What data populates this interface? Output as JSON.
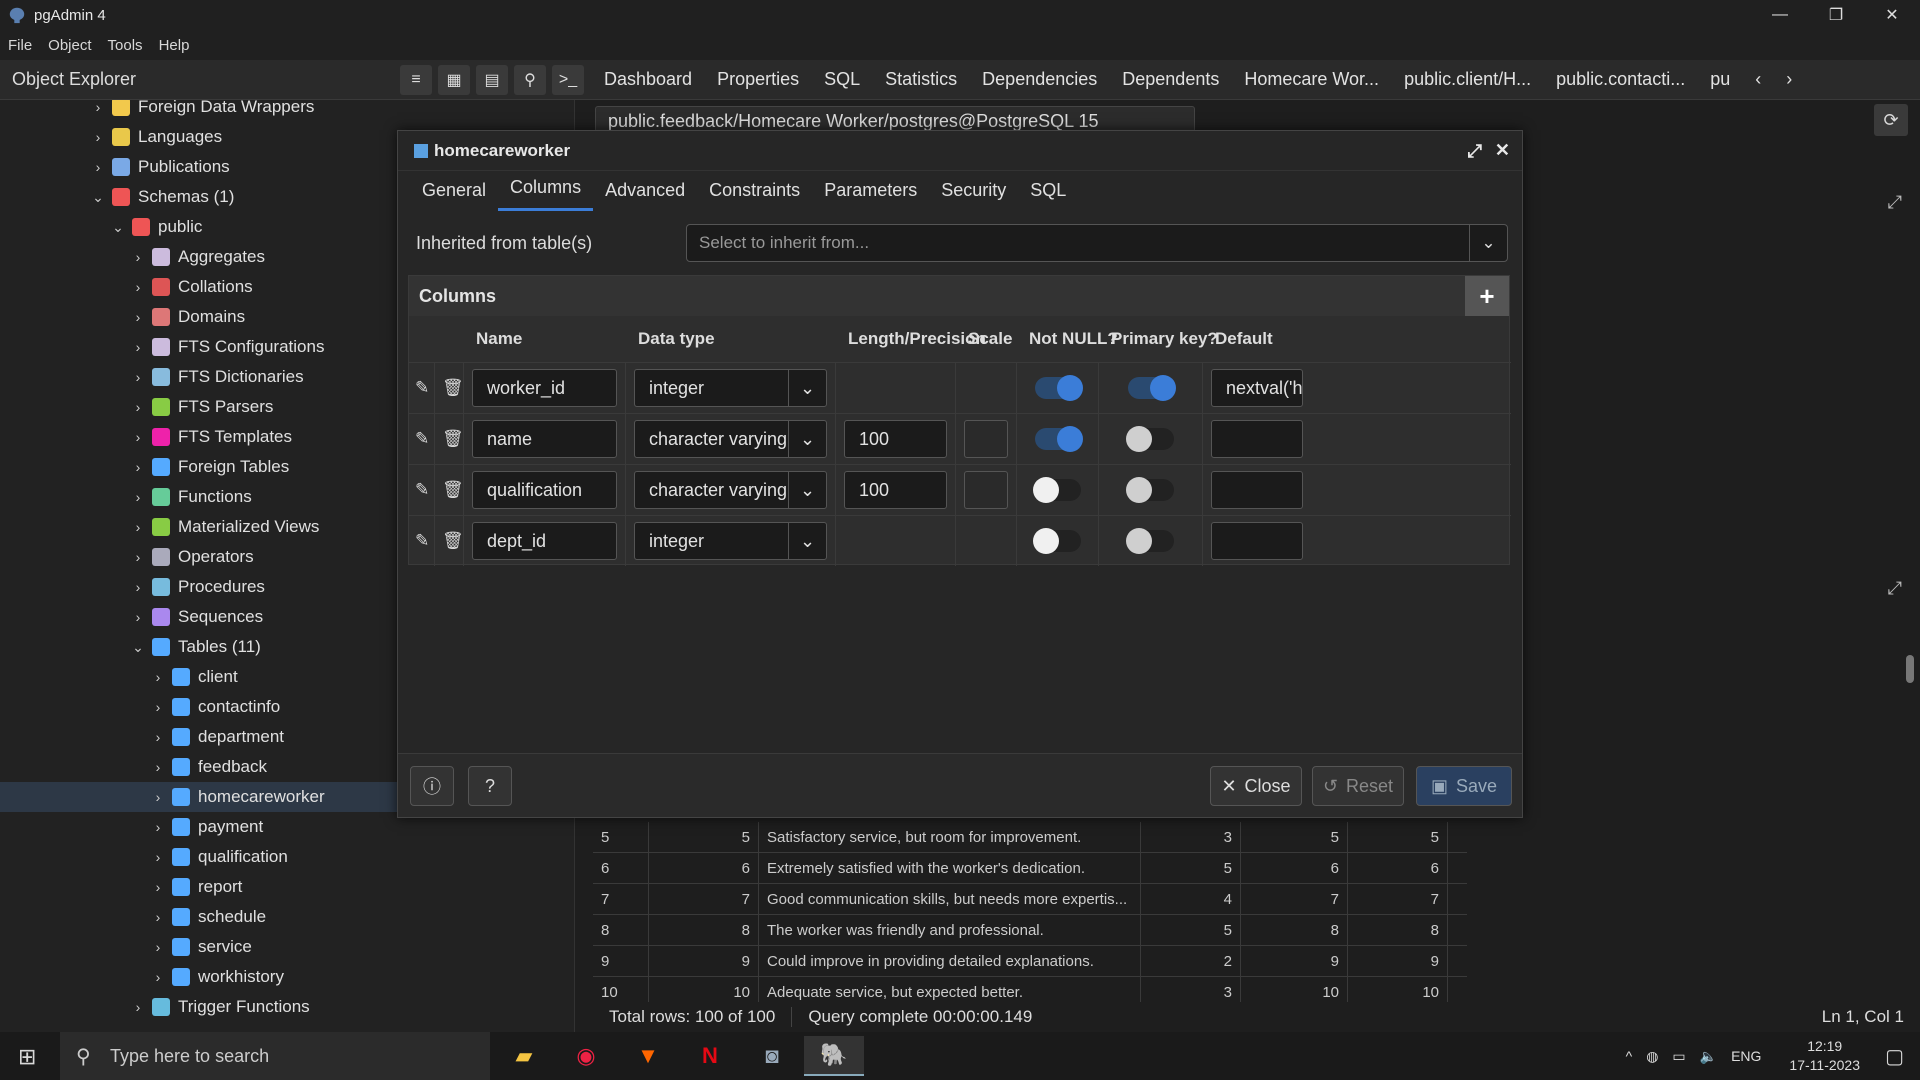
{
  "window": {
    "title": "pgAdmin 4"
  },
  "menu": [
    "File",
    "Object",
    "Tools",
    "Help"
  ],
  "explorer_title": "Object Explorer",
  "main_tabs": [
    "Dashboard",
    "Properties",
    "SQL",
    "Statistics",
    "Dependencies",
    "Dependents",
    "Homecare Wor...",
    "public.client/H...",
    "public.contacti...",
    "pu"
  ],
  "tree": [
    {
      "label": "Foreign Data Wrappers",
      "depth": 4,
      "exp": ">"
    },
    {
      "label": "Languages",
      "depth": 4,
      "exp": ">"
    },
    {
      "label": "Publications",
      "depth": 4,
      "exp": ">"
    },
    {
      "label": "Schemas (1)",
      "depth": 4,
      "exp": "v"
    },
    {
      "label": "public",
      "depth": 5,
      "exp": "v"
    },
    {
      "label": "Aggregates",
      "depth": 6,
      "exp": ">"
    },
    {
      "label": "Collations",
      "depth": 6,
      "exp": ">"
    },
    {
      "label": "Domains",
      "depth": 6,
      "exp": ">"
    },
    {
      "label": "FTS Configurations",
      "depth": 6,
      "exp": ">"
    },
    {
      "label": "FTS Dictionaries",
      "depth": 6,
      "exp": ">"
    },
    {
      "label": "FTS Parsers",
      "depth": 6,
      "exp": ">"
    },
    {
      "label": "FTS Templates",
      "depth": 6,
      "exp": ">"
    },
    {
      "label": "Foreign Tables",
      "depth": 6,
      "exp": ">"
    },
    {
      "label": "Functions",
      "depth": 6,
      "exp": ">"
    },
    {
      "label": "Materialized Views",
      "depth": 6,
      "exp": ">"
    },
    {
      "label": "Operators",
      "depth": 6,
      "exp": ">"
    },
    {
      "label": "Procedures",
      "depth": 6,
      "exp": ">"
    },
    {
      "label": "Sequences",
      "depth": 6,
      "exp": ">"
    },
    {
      "label": "Tables (11)",
      "depth": 6,
      "exp": "v"
    },
    {
      "label": "client",
      "depth": 7,
      "exp": ">"
    },
    {
      "label": "contactinfo",
      "depth": 7,
      "exp": ">"
    },
    {
      "label": "department",
      "depth": 7,
      "exp": ">"
    },
    {
      "label": "feedback",
      "depth": 7,
      "exp": ">"
    },
    {
      "label": "homecareworker",
      "depth": 7,
      "exp": ">",
      "selected": true
    },
    {
      "label": "payment",
      "depth": 7,
      "exp": ">"
    },
    {
      "label": "qualification",
      "depth": 7,
      "exp": ">"
    },
    {
      "label": "report",
      "depth": 7,
      "exp": ">"
    },
    {
      "label": "schedule",
      "depth": 7,
      "exp": ">"
    },
    {
      "label": "service",
      "depth": 7,
      "exp": ">"
    },
    {
      "label": "workhistory",
      "depth": 7,
      "exp": ">"
    },
    {
      "label": "Trigger Functions",
      "depth": 6,
      "exp": ">"
    }
  ],
  "query_tab": "public.feedback/Homecare Worker/postgres@PostgreSQL 15",
  "dialog": {
    "title": "homecareworker",
    "tabs": [
      "General",
      "Columns",
      "Advanced",
      "Constraints",
      "Parameters",
      "Security",
      "SQL"
    ],
    "active_tab": "Columns",
    "inherit_label": "Inherited from table(s)",
    "inherit_placeholder": "Select to inherit from...",
    "columns_title": "Columns",
    "headers": [
      "Name",
      "Data type",
      "Length/Precision",
      "Scale",
      "Not NULL?",
      "Primary key?",
      "Default"
    ],
    "rows": [
      {
        "name": "worker_id",
        "type": "integer",
        "length": "",
        "scale": "",
        "notnull": true,
        "pk": true,
        "default": "nextval('ho",
        "editable_len": false
      },
      {
        "name": "name",
        "type": "character varying",
        "length": "100",
        "scale": "",
        "notnull": true,
        "pk": false,
        "default": "",
        "editable_len": true
      },
      {
        "name": "qualification",
        "type": "character varying",
        "length": "100",
        "scale": "",
        "notnull": false,
        "pk": false,
        "default": "",
        "editable_len": true
      },
      {
        "name": "dept_id",
        "type": "integer",
        "length": "",
        "scale": "",
        "notnull": false,
        "pk": false,
        "default": "",
        "editable_len": false
      }
    ],
    "close_label": "Close",
    "reset_label": "Reset",
    "save_label": "Save"
  },
  "results": [
    [
      "5",
      "5",
      "Satisfactory service, but room for improvement.",
      "3",
      "5",
      "5"
    ],
    [
      "6",
      "6",
      "Extremely satisfied with the worker's dedication.",
      "5",
      "6",
      "6"
    ],
    [
      "7",
      "7",
      "Good communication skills, but needs more expertis...",
      "4",
      "7",
      "7"
    ],
    [
      "8",
      "8",
      "The worker was friendly and professional.",
      "5",
      "8",
      "8"
    ],
    [
      "9",
      "9",
      "Could improve in providing detailed explanations.",
      "2",
      "9",
      "9"
    ],
    [
      "10",
      "10",
      "Adequate service, but expected better.",
      "3",
      "10",
      "10"
    ]
  ],
  "status": {
    "rows": "Total rows: 100 of 100",
    "query": "Query complete 00:00:00.149",
    "pos": "Ln 1, Col 1"
  },
  "taskbar": {
    "search": "Type here to search",
    "lang": "ENG",
    "time": "12:19",
    "date": "17-11-2023"
  }
}
